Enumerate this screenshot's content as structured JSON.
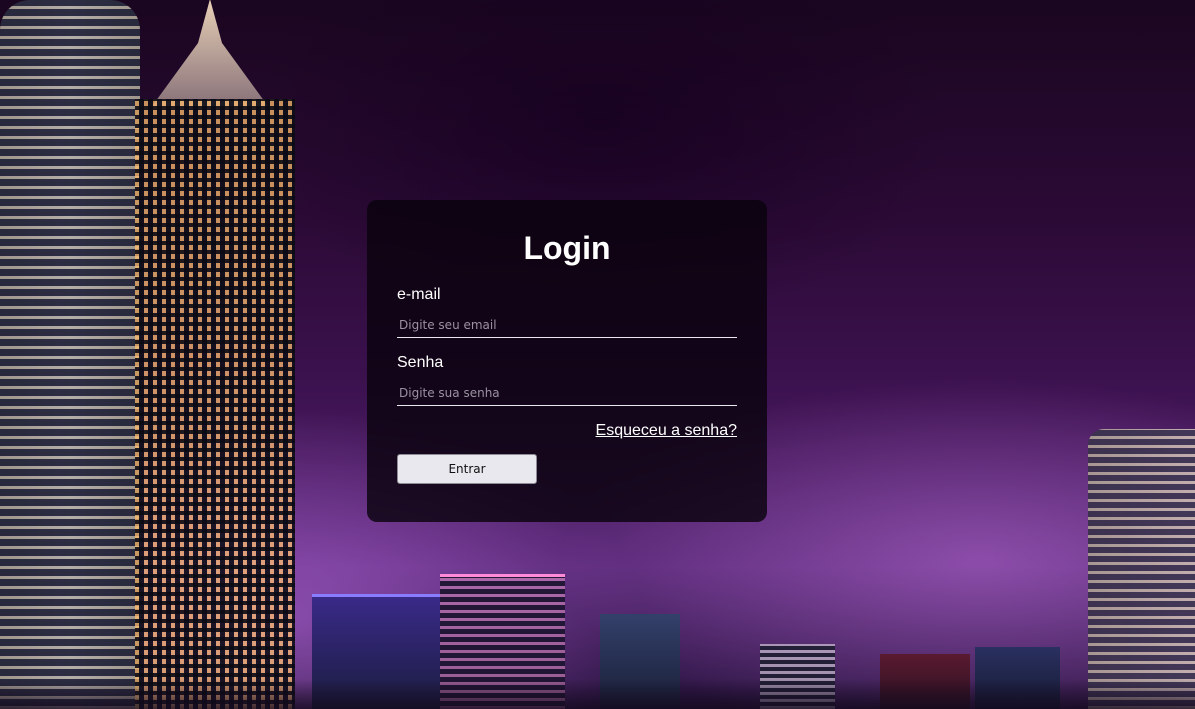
{
  "login": {
    "title": "Login",
    "email_label": "e-mail",
    "email_placeholder": "Digite seu email",
    "email_value": "",
    "password_label": "Senha",
    "password_placeholder": "Digite sua senha",
    "password_value": "",
    "forgot_link": "Esqueceu a senha?",
    "submit_label": "Entrar"
  },
  "theme": {
    "card_background": "#0a020e",
    "text_color": "#ffffff",
    "button_background": "#e9e8ee",
    "background_image": "night city skyline"
  }
}
